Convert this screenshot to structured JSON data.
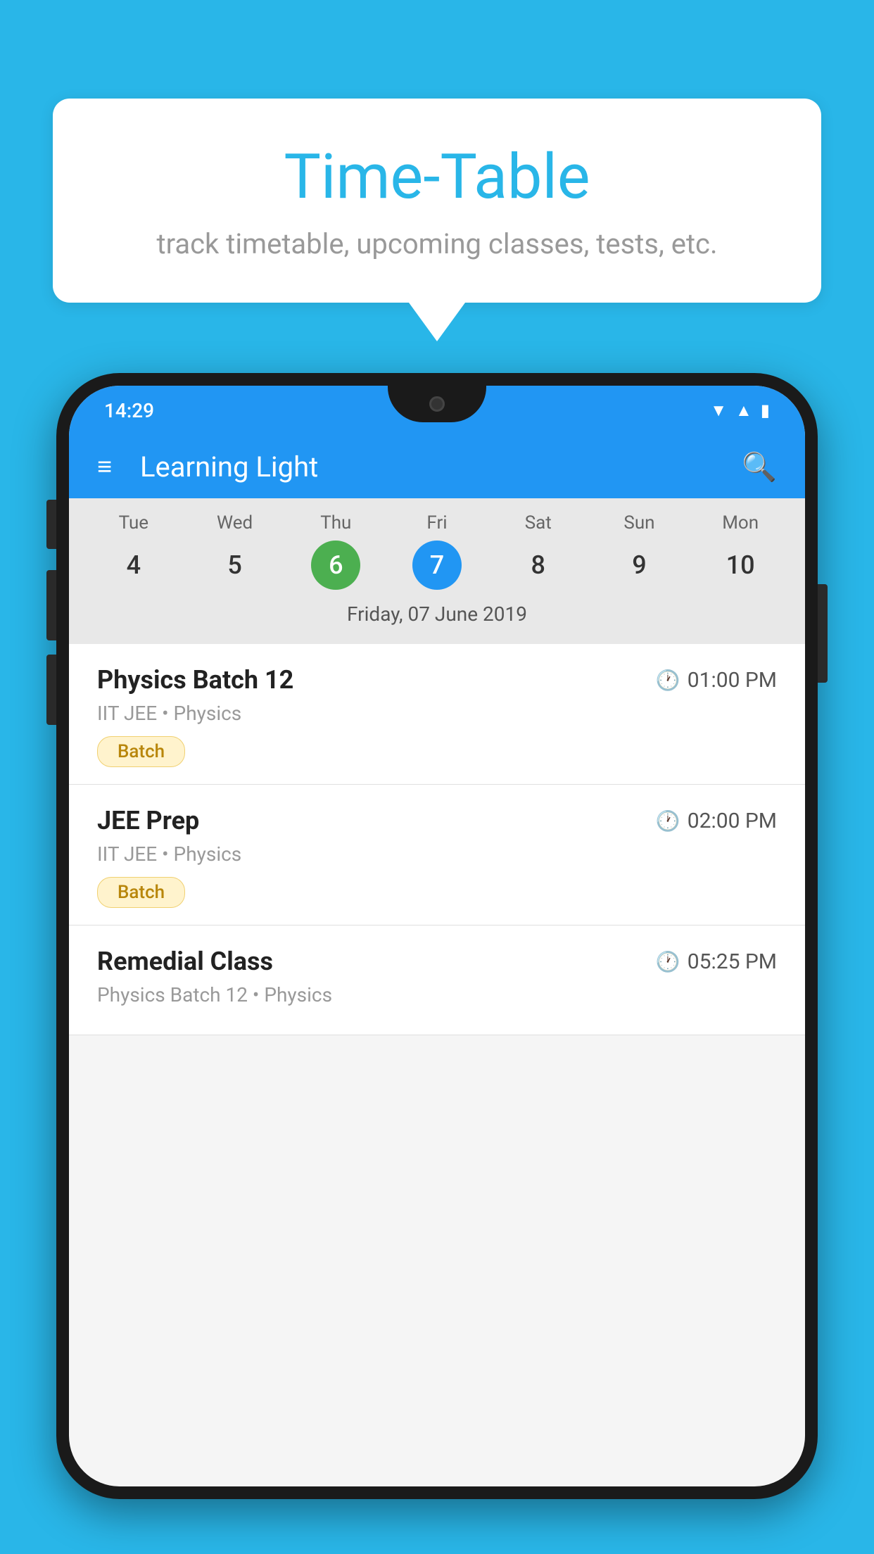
{
  "background_color": "#29b6e8",
  "speech_bubble": {
    "title": "Time-Table",
    "subtitle": "track timetable, upcoming classes, tests, etc."
  },
  "app": {
    "name": "Learning Light",
    "status_bar": {
      "time": "14:29",
      "icons": [
        "wifi",
        "signal",
        "battery"
      ]
    }
  },
  "calendar": {
    "selected_date_label": "Friday, 07 June 2019",
    "days": [
      {
        "name": "Tue",
        "num": "4",
        "state": "normal"
      },
      {
        "name": "Wed",
        "num": "5",
        "state": "normal"
      },
      {
        "name": "Thu",
        "num": "6",
        "state": "today"
      },
      {
        "name": "Fri",
        "num": "7",
        "state": "selected"
      },
      {
        "name": "Sat",
        "num": "8",
        "state": "normal"
      },
      {
        "name": "Sun",
        "num": "9",
        "state": "normal"
      },
      {
        "name": "Mon",
        "num": "10",
        "state": "normal"
      }
    ]
  },
  "schedule": [
    {
      "title": "Physics Batch 12",
      "time": "01:00 PM",
      "subtitle": "IIT JEE • Physics",
      "badge": "Batch"
    },
    {
      "title": "JEE Prep",
      "time": "02:00 PM",
      "subtitle": "IIT JEE • Physics",
      "badge": "Batch"
    },
    {
      "title": "Remedial Class",
      "time": "05:25 PM",
      "subtitle": "Physics Batch 12 • Physics",
      "badge": null
    }
  ],
  "labels": {
    "hamburger": "≡",
    "search": "🔍",
    "clock": "🕐"
  }
}
